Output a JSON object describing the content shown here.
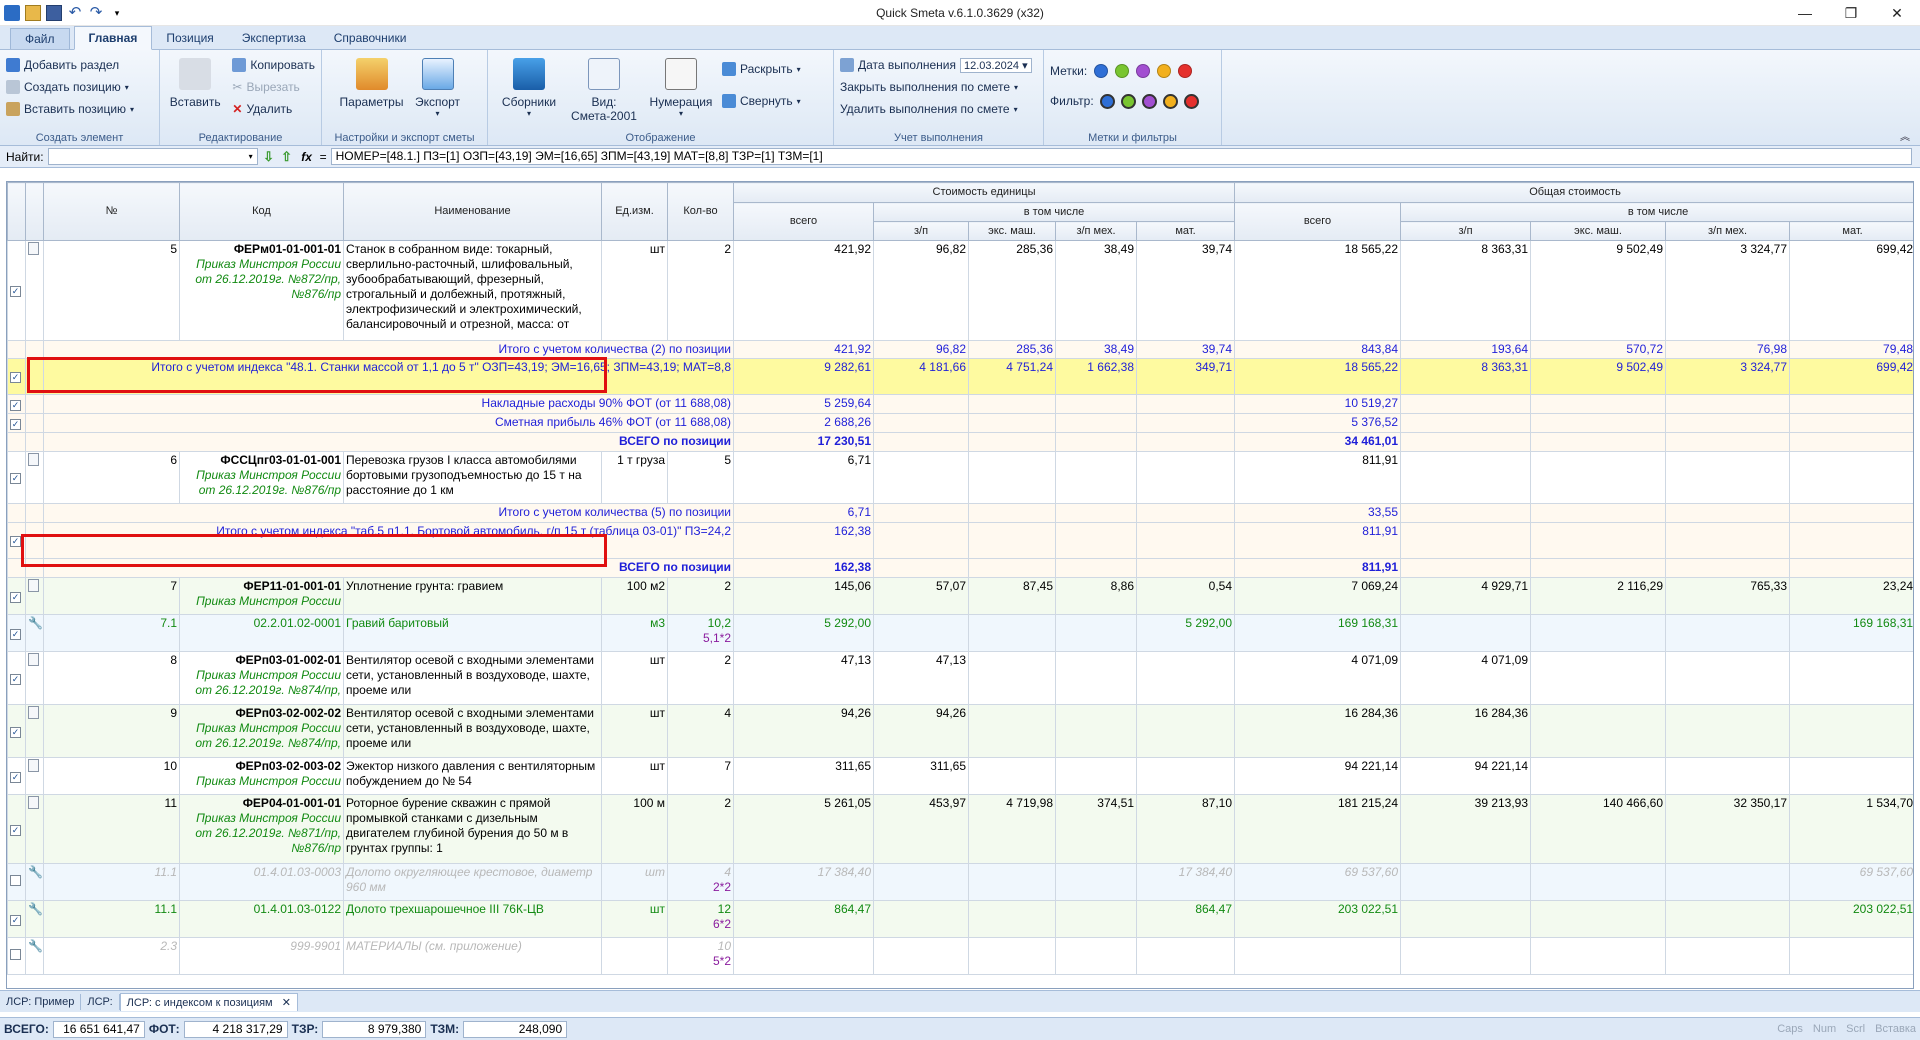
{
  "app": {
    "title": "Quick Smeta v.6.1.0.3629 (x32)"
  },
  "menu_tabs": [
    "Файл",
    "Главная",
    "Позиция",
    "Экспертиза",
    "Справочники"
  ],
  "ribbon": {
    "create": {
      "add_section": "Добавить раздел",
      "create_position": "Создать позицию",
      "insert_position": "Вставить позицию",
      "label": "Создать элемент"
    },
    "edit": {
      "paste": "Вставить",
      "copy": "Копировать",
      "cut": "Вырезать",
      "delete": "Удалить",
      "label": "Редактирование"
    },
    "settings": {
      "params": "Параметры",
      "export": "Экспорт",
      "label": "Настройки и экспорт сметы"
    },
    "view": {
      "collections": "Сборники",
      "view_line1": "Вид:",
      "view_line2": "Смета-2001",
      "numbering": "Нумерация",
      "expand": "Раскрыть",
      "collapse": "Свернуть",
      "label": "Отображение"
    },
    "accounting": {
      "date_label": "Дата выполнения",
      "date_value": "12.03.2024",
      "close": "Закрыть выполнения по смете",
      "remove": "Удалить выполнения по смете",
      "label": "Учет выполнения"
    },
    "marks": {
      "marks_label": "Метки:",
      "filter_label": "Фильтр:",
      "label": "Метки и фильтры",
      "colors": [
        "#2f6fd6",
        "#79c530",
        "#a24fd1",
        "#f2b01e",
        "#e5302d"
      ]
    }
  },
  "findbar": {
    "label": "Найти:",
    "fx": "fx",
    "eq": "=",
    "formula": "НОМЕР=[48.1.] ПЗ=[1] ОЗП=[43,19] ЭМ=[16,65] ЗПМ=[43,19] МАТ=[8,8] ТЗР=[1] ТЗМ=[1]"
  },
  "header": {
    "num": "№",
    "code": "Код",
    "name": "Наименование",
    "unit": "Ед.изм.",
    "qty": "Кол-во",
    "unit_cost": "Стоимость единицы",
    "total_cost": "Общая стоимость",
    "total": "всего",
    "incl": "в том числе",
    "zp": "з/п",
    "eksp": "экс. маш.",
    "zpmech": "з/п мех.",
    "mat": "мат."
  },
  "rows": [
    {
      "num": "5",
      "code": "ФЕРм01-01-001-01",
      "src": "Приказ Минстроя России от 26.12.2019г. №872/пр, №876/пр",
      "name": "Станок в собранном виде: токарный, сверлильно-расточный, шлифовальный, зубообрабатывающий, фрезерный, строгальный и долбежный, протяжный, электрофизический и электрохимический, балансировочный и отрезной, масса: от",
      "unit": "шт",
      "qty": "2",
      "u_total": "421,92",
      "u_zp": "96,82",
      "u_em": "285,36",
      "u_zpm": "38,49",
      "u_mat": "39,74",
      "t_total": "18 565,22",
      "t_zp": "8 363,31",
      "t_em": "9 502,49",
      "t_zpm": "3 324,77",
      "t_mat": "699,42"
    },
    {
      "label": "Итого с учетом количества (2) по позиции",
      "u_total": "421,92",
      "u_zp": "96,82",
      "u_em": "285,36",
      "u_zpm": "38,49",
      "u_mat": "39,74",
      "t_total": "843,84",
      "t_zp": "193,64",
      "t_em": "570,72",
      "t_zpm": "76,98",
      "t_mat": "79,48"
    },
    {
      "label": "Итого с учетом индекса \"48.1. Станки массой от 1,1 до 5 т\" ОЗП=43,19; ЭМ=16,65; ЗПМ=43,19; МАТ=8,8",
      "u_total": "9 282,61",
      "u_zp": "4 181,66",
      "u_em": "4 751,24",
      "u_zpm": "1 662,38",
      "u_mat": "349,71",
      "t_total": "18 565,22",
      "t_zp": "8 363,31",
      "t_em": "9 502,49",
      "t_zpm": "3 324,77",
      "t_mat": "699,42"
    },
    {
      "label": "Накладные расходы 90% ФОТ (от 11 688,08)",
      "u_total": "5 259,64",
      "t_total": "10 519,27"
    },
    {
      "label": "Сметная прибыль 46% ФОТ (от 11 688,08)",
      "u_total": "2 688,26",
      "t_total": "5 376,52"
    },
    {
      "label": "ВСЕГО по позиции",
      "u_total": "17 230,51",
      "t_total": "34 461,01"
    },
    {
      "num": "6",
      "code": "ФССЦпг03-01-01-001",
      "src": "Приказ Минстроя России от 26.12.2019г. №876/пр",
      "name": "Перевозка грузов I класса автомобилями бортовыми грузоподъемностью до 15 т на расстояние до 1 км",
      "unit": "1 т груза",
      "qty": "5",
      "u_total": "6,71",
      "t_total": "811,91"
    },
    {
      "label": "Итого с учетом количества (5) по позиции",
      "u_total": "6,71",
      "t_total": "33,55"
    },
    {
      "label": "Итого с учетом индекса \"таб.5 п1.1. Бортовой автомобиль, г/п 15 т (таблица 03-01)\" ПЗ=24,2",
      "u_total": "162,38",
      "t_total": "811,91"
    },
    {
      "label": "ВСЕГО по позиции",
      "u_total": "162,38",
      "t_total": "811,91"
    },
    {
      "num": "7",
      "code": "ФЕР11-01-001-01",
      "src": "Приказ Минстроя России",
      "name": "Уплотнение грунта: гравием",
      "unit": "100 м2",
      "qty": "2",
      "u_total": "145,06",
      "u_zp": "57,07",
      "u_em": "87,45",
      "u_zpm": "8,86",
      "u_mat": "0,54",
      "t_total": "7 069,24",
      "t_zp": "4 929,71",
      "t_em": "2 116,29",
      "t_zpm": "765,33",
      "t_mat": "23,24"
    },
    {
      "num": "7.1",
      "code": "02.2.01.02-0001",
      "name": "Гравий баритовый",
      "unit": "м3",
      "qty": "10,2",
      "qty2": "5,1*2",
      "u_total": "5 292,00",
      "u_mat": "5 292,00",
      "t_total": "169 168,31",
      "t_mat": "169 168,31"
    },
    {
      "num": "8",
      "code": "ФЕРп03-01-002-01",
      "src": "Приказ Минстроя России от 26.12.2019г. №874/пр,",
      "name": "Вентилятор осевой с входными элементами сети, установленный в воздуховоде, шахте, проеме или",
      "unit": "шт",
      "qty": "2",
      "u_total": "47,13",
      "u_zp": "47,13",
      "t_total": "4 071,09",
      "t_zp": "4 071,09"
    },
    {
      "num": "9",
      "code": "ФЕРп03-02-002-02",
      "src": "Приказ Минстроя России от 26.12.2019г. №874/пр,",
      "name": "Вентилятор осевой с входными элементами сети, установленный в воздуховоде, шахте, проеме или",
      "unit": "шт",
      "qty": "4",
      "u_total": "94,26",
      "u_zp": "94,26",
      "t_total": "16 284,36",
      "t_zp": "16 284,36"
    },
    {
      "num": "10",
      "code": "ФЕРп03-02-003-02",
      "src": "Приказ Минстроя России",
      "name": "Эжектор низкого давления с вентиляторным побуждением до № 54",
      "unit": "шт",
      "qty": "7",
      "u_total": "311,65",
      "u_zp": "311,65",
      "t_total": "94 221,14",
      "t_zp": "94 221,14"
    },
    {
      "num": "11",
      "code": "ФЕР04-01-001-01",
      "src": "Приказ Минстроя России от 26.12.2019г. №871/пр, №876/пр",
      "name": "Роторное бурение скважин с прямой промывкой станками с дизельным двигателем глубиной бурения до 50 м в грунтах группы: 1",
      "unit": "100 м",
      "qty": "2",
      "u_total": "5 261,05",
      "u_zp": "453,97",
      "u_em": "4 719,98",
      "u_zpm": "374,51",
      "u_mat": "87,10",
      "t_total": "181 215,24",
      "t_zp": "39 213,93",
      "t_em": "140 466,60",
      "t_zpm": "32 350,17",
      "t_mat": "1 534,70"
    },
    {
      "num": "11.1",
      "code": "01.4.01.03-0003",
      "name": "Долото округляющее крестовое, диаметр 960 мм",
      "unit": "шт",
      "qty": "4",
      "qty2": "2*2",
      "u_total": "17 384,40",
      "u_mat": "17 384,40",
      "t_total": "69 537,60",
      "t_mat": "69 537,60"
    },
    {
      "num": "11.1",
      "code": "01.4.01.03-0122",
      "name": "Долото трехшарошечное III 76К-ЦВ",
      "unit": "шт",
      "qty": "12",
      "qty2": "6*2",
      "u_total": "864,47",
      "u_mat": "864,47",
      "t_total": "203 022,51",
      "t_mat": "203 022,51"
    },
    {
      "num": "2.3",
      "code": "999-9901",
      "name": "МАТЕРИАЛЫ (см. приложение)",
      "qty": "10",
      "qty2": "5*2"
    }
  ],
  "doc_tabs": [
    "ЛСР: Пример",
    "ЛСР:",
    "ЛСР: с индексом к позициям"
  ],
  "status": {
    "total_label": "ВСЕГО:",
    "total": "16 651 641,47",
    "fot_label": "ФОТ:",
    "fot": "4 218 317,29",
    "tzr_label": "ТЗР:",
    "tzr": "8 979,380",
    "tzm_label": "ТЗМ:",
    "tzm": "248,090",
    "indicators": [
      "Caps",
      "Num",
      "Scrl",
      "Вставка"
    ]
  }
}
